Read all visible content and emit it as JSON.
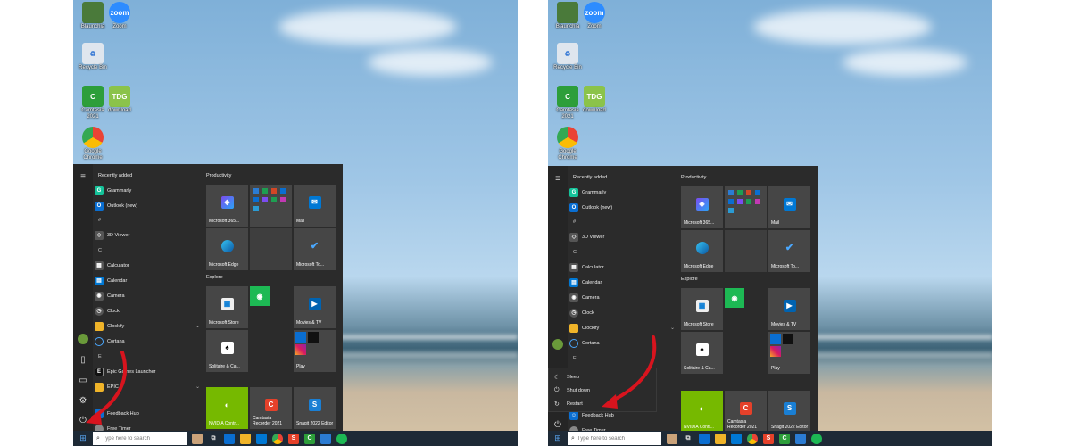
{
  "desktop_icons": [
    {
      "label": "Blaunchia"
    },
    {
      "label": "Zoom",
      "icon_text": "zoom"
    },
    {
      "label": "Recycle Bin"
    },
    {
      "label": "Camtasia 2021"
    },
    {
      "label": "download",
      "icon_text": "TDG"
    },
    {
      "label": "Google Chrome"
    }
  ],
  "start_menu": {
    "recently_added_header": "Recently added",
    "apps": {
      "grammarly": "Grammarly",
      "outlook": "Outlook (new)",
      "hash_header": "#",
      "viewer3d": "3D Viewer",
      "c_header": "C",
      "calculator": "Calculator",
      "calendar": "Calendar",
      "camera": "Camera",
      "clock": "Clock",
      "clockify": "Clockify",
      "cortana": "Cortana",
      "e_header": "E",
      "epic": "Epic Games Launcher",
      "epic_folder": "EPIC",
      "feedback": "Feedback Hub",
      "free_timer": "Free Timer"
    },
    "groups": {
      "productivity": "Productivity",
      "explore": "Explore"
    },
    "tiles": {
      "m365": "Microsoft 365...",
      "mail": "Mail",
      "edge": "Microsoft Edge",
      "todo": "Microsoft To...",
      "store": "Microsoft Store",
      "movies": "Movies & TV",
      "solitaire": "Solitaire & Ca...",
      "play": "Play",
      "nvidia": "NVIDIA Contr...",
      "camtasia": "Camtasia Recorder 2021",
      "snagit": "Snagit 2022 Editor"
    }
  },
  "power_menu": {
    "sleep": "Sleep",
    "shutdown": "Shut down",
    "restart": "Restart"
  },
  "taskbar": {
    "search_placeholder": "Type here to search"
  },
  "colors": {
    "accent_arrow": "#d8141e",
    "start_bg": "#2b2b2b",
    "taskbar_bg": "#1e2a36"
  }
}
